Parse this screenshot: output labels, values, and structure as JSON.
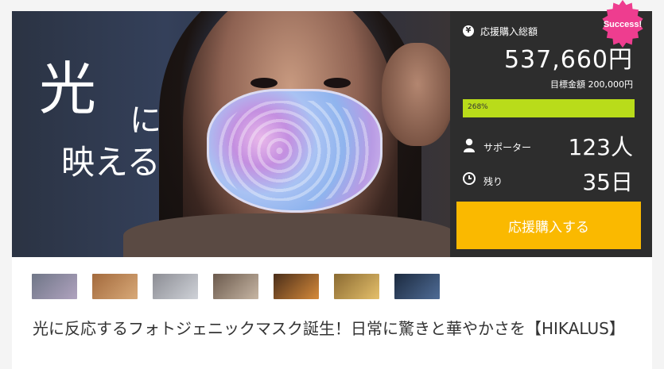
{
  "hero": {
    "line1": "光",
    "line2": "に",
    "line3": "映える"
  },
  "badge": {
    "label": "Success!",
    "color": "#ee3d8f"
  },
  "funding": {
    "total_label": "応援購入総額",
    "total_amount": "537,660円",
    "goal_text": "目標金額 200,000円",
    "progress_text": "268%",
    "progress_fraction": 1.0,
    "progress_color": "#b9dc1a"
  },
  "supporters": {
    "label": "サポーター",
    "value": "123人",
    "icon": "person-icon"
  },
  "remaining": {
    "label": "残り",
    "value": "35日",
    "icon": "clock-icon"
  },
  "cta": {
    "label": "応援購入する",
    "color": "#fab900"
  },
  "thumbnails": [
    {
      "name": "thumb-1",
      "colors": [
        "#6f7687",
        "#b0a3bf"
      ]
    },
    {
      "name": "thumb-2",
      "colors": [
        "#a36a3d",
        "#d8a978"
      ]
    },
    {
      "name": "thumb-3",
      "colors": [
        "#8c8d94",
        "#cfd2d8"
      ]
    },
    {
      "name": "thumb-4",
      "colors": [
        "#6b5a4d",
        "#c7b6a4"
      ]
    },
    {
      "name": "thumb-5",
      "colors": [
        "#4a2e1a",
        "#d68a3a"
      ]
    },
    {
      "name": "thumb-6",
      "colors": [
        "#8a6a32",
        "#e5c06b"
      ]
    },
    {
      "name": "thumb-7",
      "colors": [
        "#1c2a3f",
        "#4f6c96"
      ]
    }
  ],
  "project_title": "光に反応するフォトジェニックマスク誕生！日常に驚きと華やかさを【HIKALUS】"
}
